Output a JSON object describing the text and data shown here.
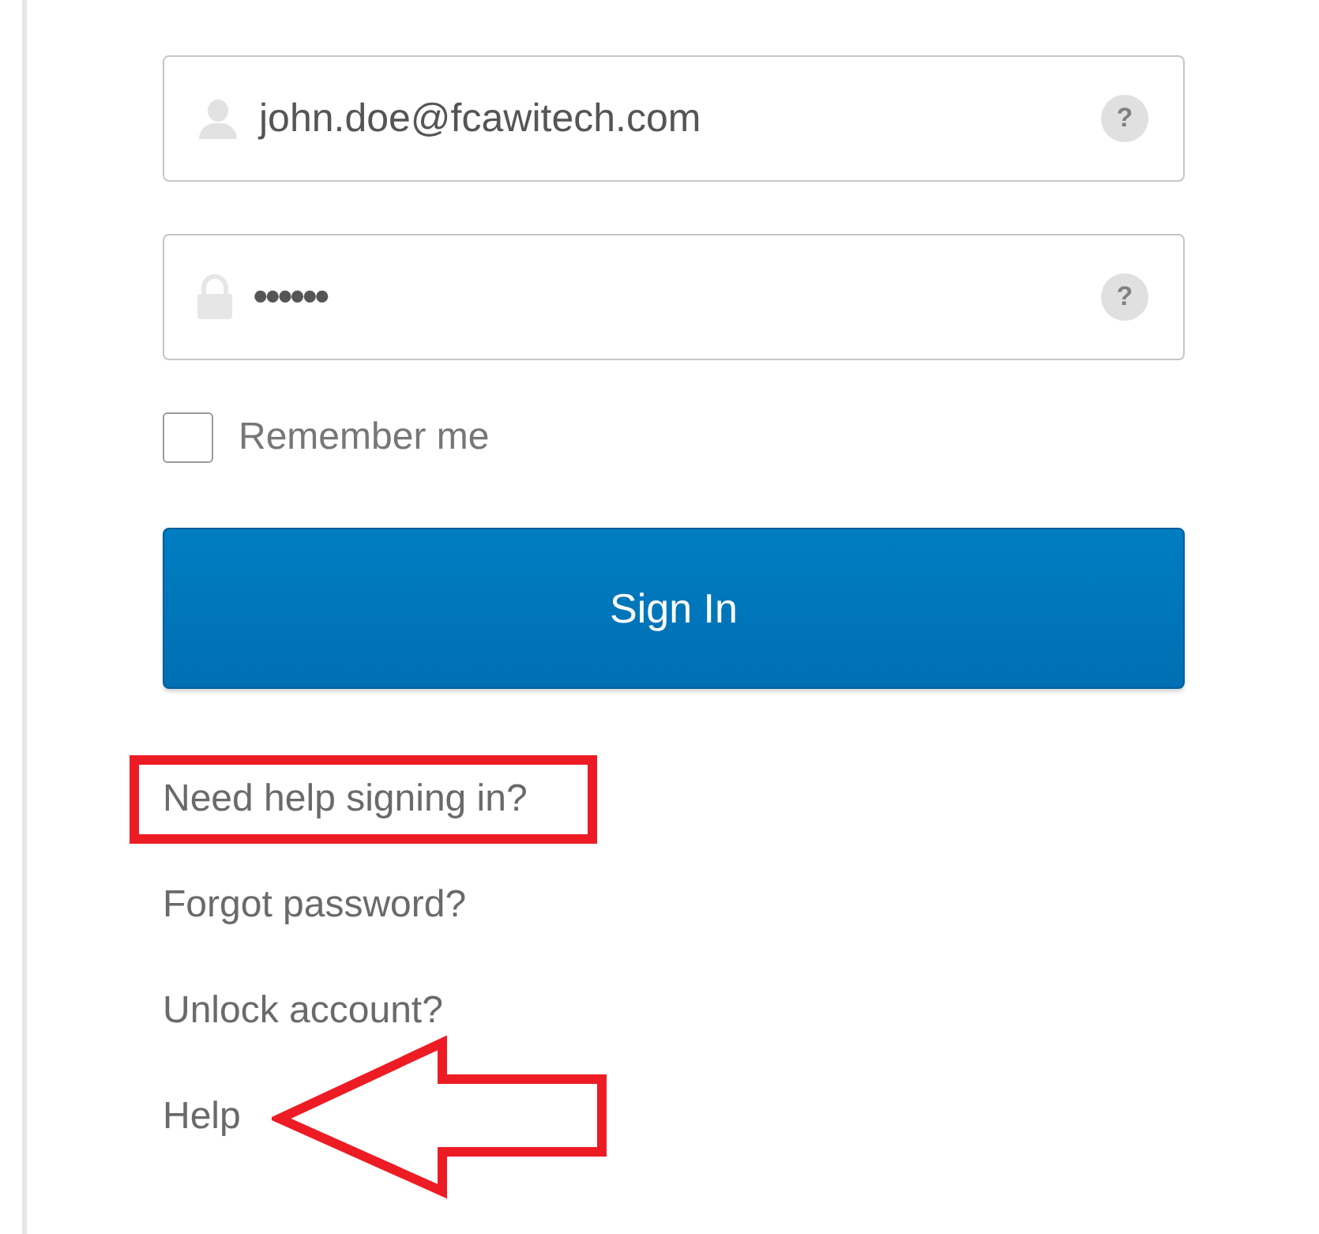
{
  "fields": [
    {
      "kind": "user",
      "value": "john.doe@fcawitech.com",
      "hint_icon": "?"
    },
    {
      "kind": "lock",
      "value": "••••••",
      "hint_icon": "?"
    }
  ],
  "remember": {
    "label": "Remember me",
    "checked": false
  },
  "sign_in_button": "Sign In",
  "links": [
    {
      "label": "Need help signing in?",
      "highlighted": true,
      "pointed_at": false
    },
    {
      "label": "Forgot password?",
      "highlighted": false,
      "pointed_at": false
    },
    {
      "label": "Unlock account?",
      "highlighted": false,
      "pointed_at": false
    },
    {
      "label": "Help",
      "highlighted": false,
      "pointed_at": true
    }
  ]
}
